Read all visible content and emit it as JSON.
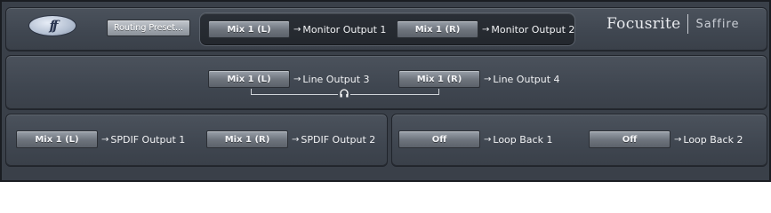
{
  "logo": {
    "mark": "ff"
  },
  "brand": {
    "name": "Focusrite",
    "product": "Saffire"
  },
  "toolbar": {
    "routing_preset_label": "Routing Preset..."
  },
  "monitor": {
    "out1": {
      "source": "Mix 1 (L)",
      "arrow": "→",
      "destination": "Monitor Output 1"
    },
    "out2": {
      "source": "Mix 1 (R)",
      "arrow": "→",
      "destination": "Monitor Output 2"
    }
  },
  "line": {
    "out3": {
      "source": "Mix 1 (L)",
      "arrow": "→",
      "destination": "Line Output 3"
    },
    "out4": {
      "source": "Mix 1 (R)",
      "arrow": "→",
      "destination": "Line Output 4"
    },
    "headphone_icon": "headphone-icon"
  },
  "spdif": {
    "out1": {
      "source": "Mix 1 (L)",
      "arrow": "→",
      "destination": "SPDIF Output 1"
    },
    "out2": {
      "source": "Mix 1 (R)",
      "arrow": "→",
      "destination": "SPDIF Output 2"
    }
  },
  "loopback": {
    "lb1": {
      "source": "Off",
      "arrow": "→",
      "destination": "Loop Back 1"
    },
    "lb2": {
      "source": "Off",
      "arrow": "→",
      "destination": "Loop Back 2"
    }
  }
}
